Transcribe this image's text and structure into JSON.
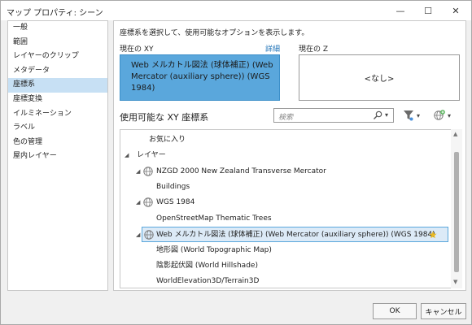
{
  "window": {
    "title": "マップ プロパティ: シーン",
    "minimize_glyph": "—",
    "maximize_glyph": "☐",
    "close_glyph": "✕"
  },
  "sidebar": {
    "items": [
      {
        "label": "一般",
        "active": false
      },
      {
        "label": "範囲",
        "active": false
      },
      {
        "label": "レイヤーのクリップ",
        "active": false
      },
      {
        "label": "メタデータ",
        "active": false
      },
      {
        "label": "座標系",
        "active": true
      },
      {
        "label": "座標変換",
        "active": false
      },
      {
        "label": "イルミネーション",
        "active": false
      },
      {
        "label": "ラベル",
        "active": false
      },
      {
        "label": "色の管理",
        "active": false
      },
      {
        "label": "屋内レイヤー",
        "active": false
      }
    ]
  },
  "main": {
    "instruction": "座標系を選択して、使用可能なオプションを表示します。",
    "current_xy_label": "現在の XY",
    "details_link": "詳細",
    "current_z_label": "現在の Z",
    "current_xy_value": "Web メルカトル図法 (球体補正) (Web Mercator (auxiliary sphere)) (WGS 1984)",
    "current_z_value": "<なし>",
    "available_label": "使用可能な XY 座標系",
    "search_placeholder": "検索"
  },
  "tree": {
    "rows": [
      {
        "label": "お気に入り",
        "arrow": "",
        "globe": false
      },
      {
        "label": "レイヤー",
        "arrow": "◢",
        "globe": false
      },
      {
        "label": "NZGD 2000 New Zealand Transverse Mercator",
        "arrow": "◢",
        "globe": true
      },
      {
        "label": "Buildings",
        "arrow": "",
        "globe": false
      },
      {
        "label": "WGS 1984",
        "arrow": "◢",
        "globe": true
      },
      {
        "label": "OpenStreetMap Thematic Trees",
        "arrow": "",
        "globe": false
      },
      {
        "label": "Web メルカトル図法 (球体補正) (Web Mercator (auxiliary sphere)) (WGS 1984)",
        "arrow": "◢",
        "globe": true,
        "selected": true
      },
      {
        "label": "地形図 (World Topographic Map)",
        "arrow": "",
        "globe": false
      },
      {
        "label": "陰影起伏図 (World Hillshade)",
        "arrow": "",
        "globe": false
      },
      {
        "label": "WorldElevation3D/Terrain3D",
        "arrow": "",
        "globe": false
      }
    ]
  },
  "footer": {
    "ok_label": "OK",
    "cancel_label": "キャンセル"
  },
  "colors": {
    "accent": "#5aa7dc",
    "selected_nav": "#c7e0f4",
    "link": "#1a6fb5"
  }
}
